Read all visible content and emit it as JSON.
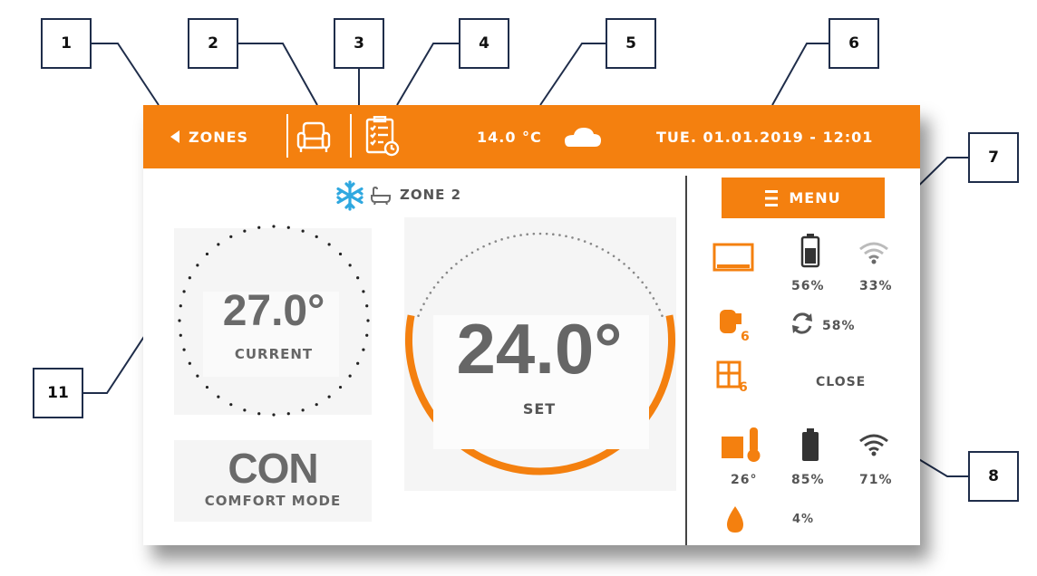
{
  "callouts": [
    "1",
    "2",
    "3",
    "4",
    "5",
    "6",
    "7",
    "8",
    "11"
  ],
  "topbar": {
    "zones_label": "ZONES",
    "temperature": "14.0 °C",
    "datetime": "TUE. 01.01.2019 - 12:01",
    "icons": [
      "back-arrow-icon",
      "armchair-icon",
      "schedule-icon",
      "cloud-icon"
    ]
  },
  "zone": {
    "name": "ZONE 2",
    "icons": [
      "snowflake-icon",
      "bathtub-icon"
    ]
  },
  "current": {
    "value": "27.0°",
    "label": "CURRENT"
  },
  "set": {
    "value": "24.0°",
    "label": "SET"
  },
  "mode": {
    "code": "CON",
    "label": "COMFORT MODE"
  },
  "menu": {
    "label": "MENU"
  },
  "status": {
    "panel_battery": "56%",
    "panel_signal": "33%",
    "actuator_count": "6",
    "actuator_opening": "58%",
    "window_count": "6",
    "window_state": "CLOSE",
    "sensor_temp": "26°",
    "sensor_battery": "85%",
    "sensor_signal": "71%",
    "humidity": "4%"
  },
  "colors": {
    "accent": "#f4800f",
    "snowflake": "#2fa8e0",
    "text": "#6a6a6a"
  }
}
